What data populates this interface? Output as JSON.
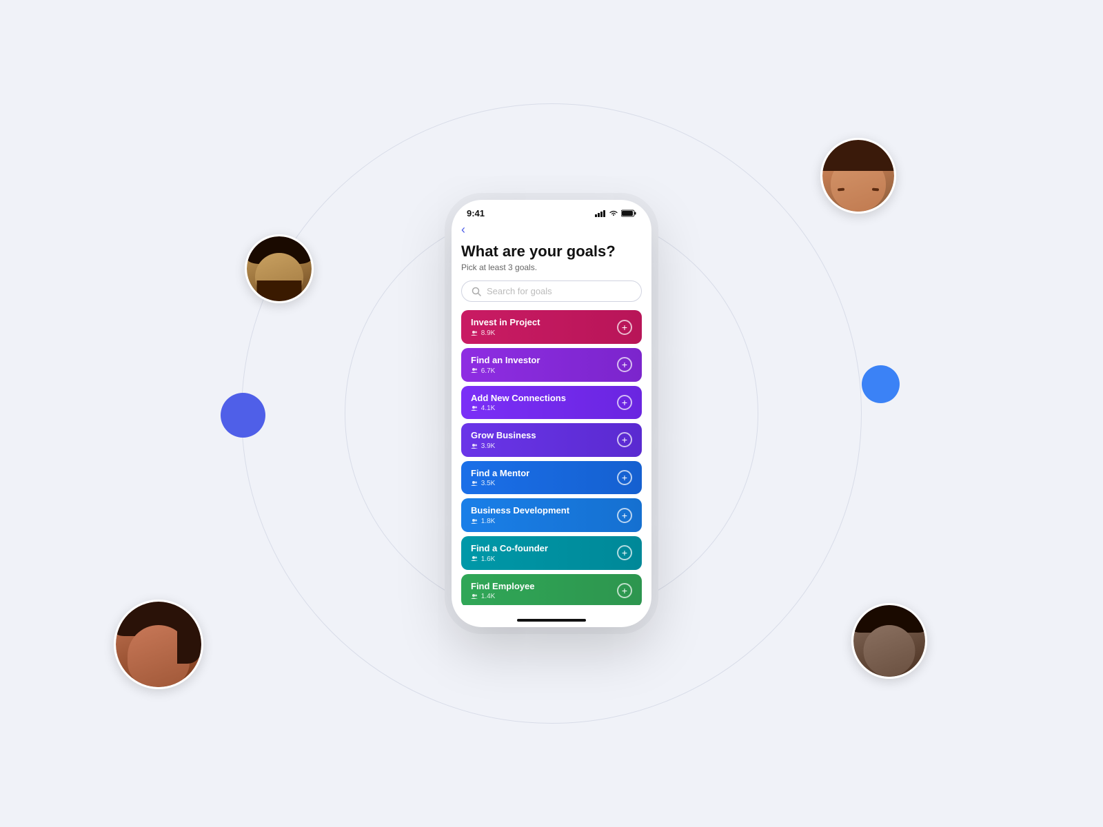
{
  "background": {
    "color": "#f0f2f8"
  },
  "decorations": {
    "dot_left_color": "#4f5fe8",
    "dot_right_color": "#3b82f6"
  },
  "phone": {
    "status_bar": {
      "time": "9:41",
      "signal": "▐▐▐▌",
      "wifi": "wifi",
      "battery": "battery"
    },
    "back_label": "‹",
    "title": "What are your goals?",
    "subtitle": "Pick at least 3 goals.",
    "search": {
      "placeholder": "Search for goals"
    },
    "goals": [
      {
        "name": "Invest in Project",
        "count": "👥 8.9K",
        "color": "#c91b63",
        "color2": "#b81558"
      },
      {
        "name": "Find an Investor",
        "count": "👥 6.7K",
        "color": "#8e2de2",
        "color2": "#7b25cc"
      },
      {
        "name": "Add New Connections",
        "count": "👥 4.1K",
        "color": "#7b2ff7",
        "color2": "#6a25e0"
      },
      {
        "name": "Grow Business",
        "count": "👥 3.9K",
        "color": "#6a35e8",
        "color2": "#5a2ad0"
      },
      {
        "name": "Find a Mentor",
        "count": "👥 3.5K",
        "color": "#1a6fe8",
        "color2": "#1560d0"
      },
      {
        "name": "Business Development",
        "count": "👥 1.8K",
        "color": "#1a7fe8",
        "color2": "#1570d0"
      },
      {
        "name": "Find a Co-founder",
        "count": "👥 1.6K",
        "color": "#0098a8",
        "color2": "#008898"
      },
      {
        "name": "Find Employee",
        "count": "👥 1.4K",
        "color": "#1a9e45",
        "color2": "#178a3c"
      }
    ]
  }
}
